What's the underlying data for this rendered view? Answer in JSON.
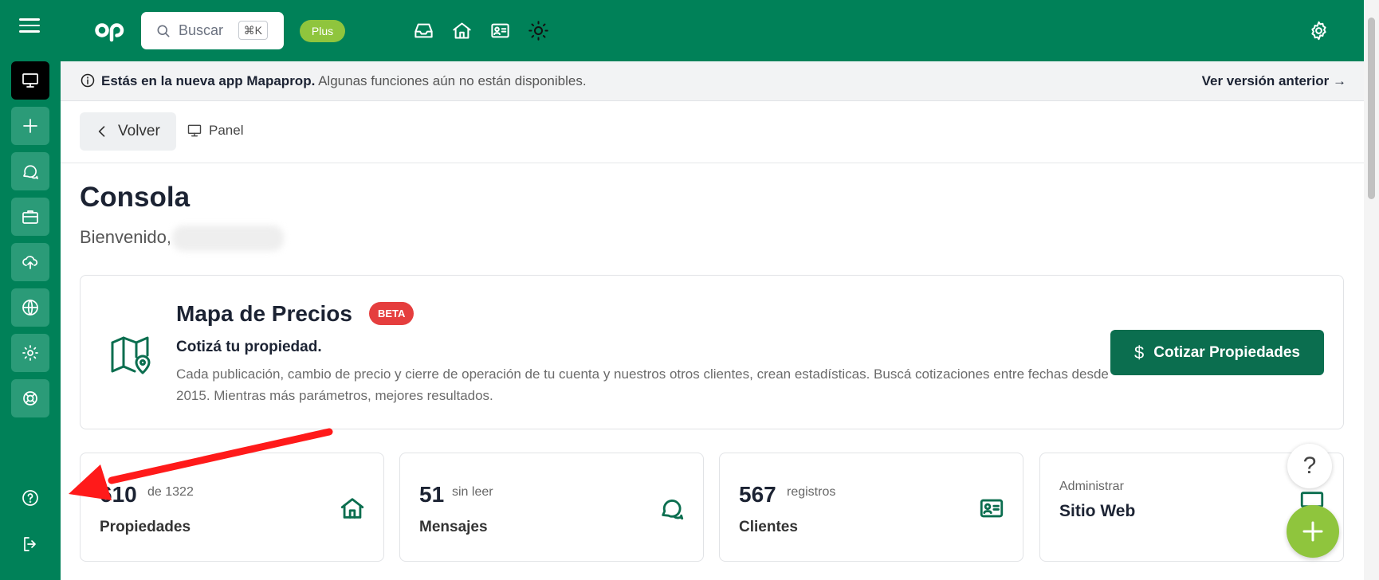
{
  "topbar": {
    "search_placeholder": "Buscar",
    "search_shortcut": "⌘K",
    "plan_badge": "Plus"
  },
  "banner": {
    "bold_text": "Estás en la nueva app Mapaprop.",
    "text": " Algunas funciones aún no están disponibles.",
    "link": "Ver versión anterior →"
  },
  "nav": {
    "back_label": "Volver",
    "crumb": "Panel"
  },
  "page": {
    "title": "Consola",
    "welcome": "Bienvenido,"
  },
  "map_card": {
    "title": "Mapa de Precios",
    "badge": "BETA",
    "subtitle": "Cotizá tu propiedad.",
    "description": "Cada publicación, cambio de precio y cierre de operación de tu cuenta y nuestros otros clientes, crean estadísticas. Buscá cotizaciones entre fechas desde 2015. Mientras más parámetros, mejores resultados.",
    "button_label": "Cotizar Propiedades"
  },
  "stats": {
    "propiedades": {
      "value": "610",
      "suffix": "de 1322",
      "label": "Propiedades"
    },
    "mensajes": {
      "value": "51",
      "suffix": "sin leer",
      "label": "Mensajes"
    },
    "clientes": {
      "value": "567",
      "suffix": "registros",
      "label": "Clientes"
    },
    "sitio": {
      "small": "Administrar",
      "big": "Sitio Web"
    }
  },
  "help_fab": "?",
  "colors": {
    "brand_green": "#008158",
    "dark_green": "#0b6e4f",
    "lime": "#8fc53d",
    "beta_red": "#e53e3e",
    "annotation_red": "#ff1a1a"
  },
  "icons": {
    "sidebar": [
      "monitor-icon",
      "plus-icon",
      "chat-icon",
      "briefcase-icon",
      "cloud-icon",
      "globe-icon",
      "gear-icon",
      "lifebuoy-icon",
      "help-circle-icon",
      "logout-icon"
    ],
    "topbar": [
      "inbox-icon",
      "home-icon",
      "contact-card-icon",
      "sun-icon",
      "settings-icon"
    ]
  }
}
